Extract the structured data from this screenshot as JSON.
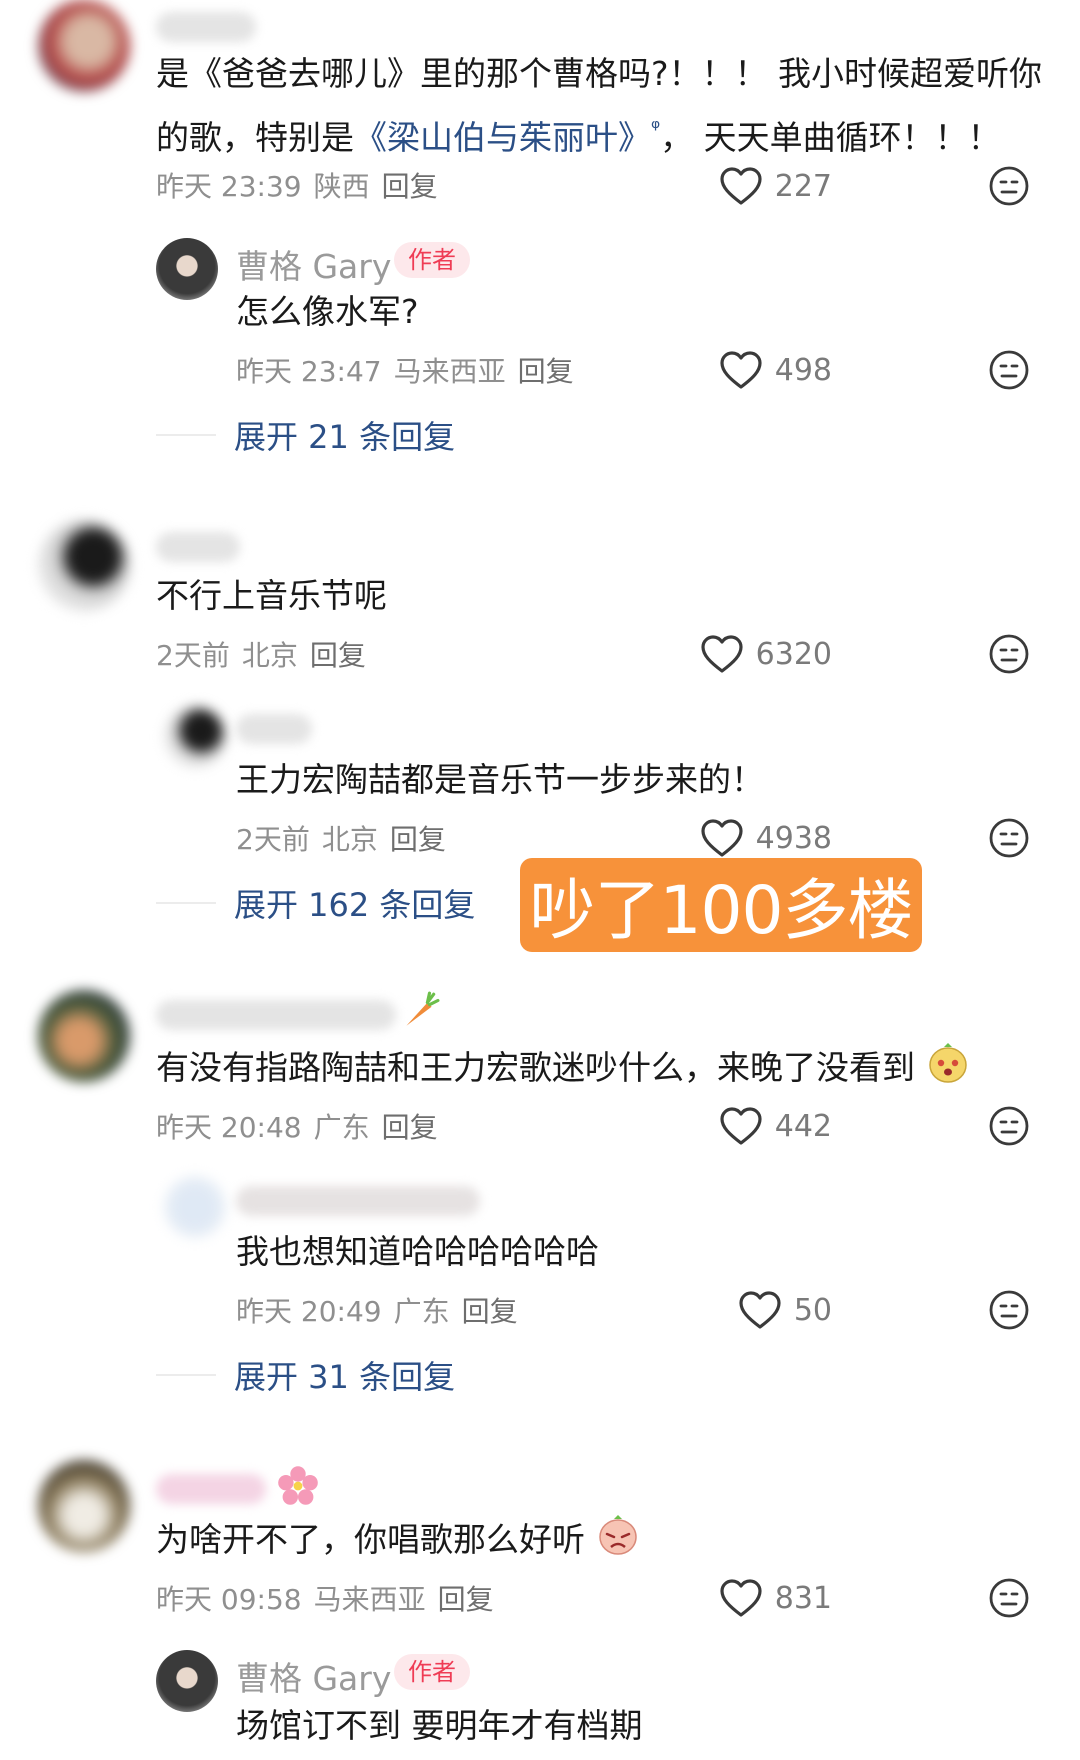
{
  "comments": [
    {
      "text_prefix": "是《爸爸去哪儿》里的那个曹格吗?！！！ 我小时候超爱听你",
      "text_line2_prefix": "的歌，特别是",
      "song_link": "《梁山伯与茱丽叶》",
      "search_mark": "ᵠ",
      "text_line2_suffix": "，  天天单曲循环！！！",
      "date": "昨天 23:39",
      "location": "陕西",
      "reply_label": "回复",
      "likes": "227",
      "replies": [
        {
          "author": "曹格 Gary",
          "badge": "作者",
          "text": "怎么像水军?",
          "date": "昨天 23:47",
          "location": "马来西亚",
          "reply_label": "回复",
          "likes": "498"
        }
      ],
      "expand_label": "展开 21 条回复"
    },
    {
      "text": "不行上音乐节呢",
      "date": "2天前",
      "location": "北京",
      "reply_label": "回复",
      "likes": "6320",
      "replies": [
        {
          "text": "王力宏陶喆都是音乐节一步步来的！",
          "date": "2天前",
          "location": "北京",
          "reply_label": "回复",
          "likes": "4938"
        }
      ],
      "expand_label": "展开 162 条回复"
    },
    {
      "text": "有没有指路陶喆和王力宏歌迷吵什么，来晚了没看到",
      "date": "昨天 20:48",
      "location": "广东",
      "reply_label": "回复",
      "likes": "442",
      "replies": [
        {
          "text": "我也想知道哈哈哈哈哈哈",
          "date": "昨天 20:49",
          "location": "广东",
          "reply_label": "回复",
          "likes": "50"
        }
      ],
      "expand_label": "展开 31 条回复"
    },
    {
      "text": "为啥开不了，你唱歌那么好听",
      "date": "昨天 09:58",
      "location": "马来西亚",
      "reply_label": "回复",
      "likes": "831",
      "replies": [
        {
          "author": "曹格 Gary",
          "badge": "作者",
          "text": "场馆订不到 要明年才有档期"
        }
      ]
    }
  ],
  "annotation": {
    "text": "吵了100多楼",
    "color": "#f7923a"
  },
  "colors": {
    "link": "#2b4f86",
    "badge": "#ef3c55",
    "meta": "#8f8f8f"
  },
  "icons": [
    "heart-outline-icon",
    "dislike-face-icon",
    "search-icon"
  ]
}
